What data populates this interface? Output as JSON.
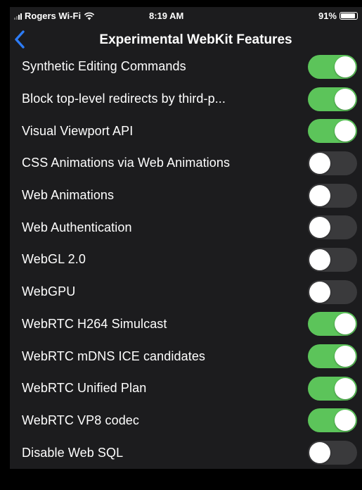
{
  "status_bar": {
    "carrier": "Rogers Wi-Fi",
    "time": "8:19 AM",
    "battery": "91%",
    "battery_level": 0.91
  },
  "nav": {
    "back_icon": "chevron-left-icon",
    "title": "Experimental WebKit Features"
  },
  "colors": {
    "toggle_on": "#5cc45a",
    "toggle_off": "#3a3a3c",
    "back_accent": "#2d7cf6",
    "background": "#1c1c1e"
  },
  "features": [
    {
      "label": "Synthetic Editing Commands",
      "enabled": true
    },
    {
      "label": "Block top-level redirects by third-p...",
      "enabled": true
    },
    {
      "label": "Visual Viewport API",
      "enabled": true
    },
    {
      "label": "CSS Animations via Web Animations",
      "enabled": false
    },
    {
      "label": "Web Animations",
      "enabled": false
    },
    {
      "label": "Web Authentication",
      "enabled": false
    },
    {
      "label": "WebGL 2.0",
      "enabled": false
    },
    {
      "label": "WebGPU",
      "enabled": false
    },
    {
      "label": "WebRTC H264 Simulcast",
      "enabled": true
    },
    {
      "label": "WebRTC mDNS ICE candidates",
      "enabled": true
    },
    {
      "label": "WebRTC Unified Plan",
      "enabled": true
    },
    {
      "label": "WebRTC VP8 codec",
      "enabled": true
    },
    {
      "label": "Disable Web SQL",
      "enabled": false
    }
  ]
}
